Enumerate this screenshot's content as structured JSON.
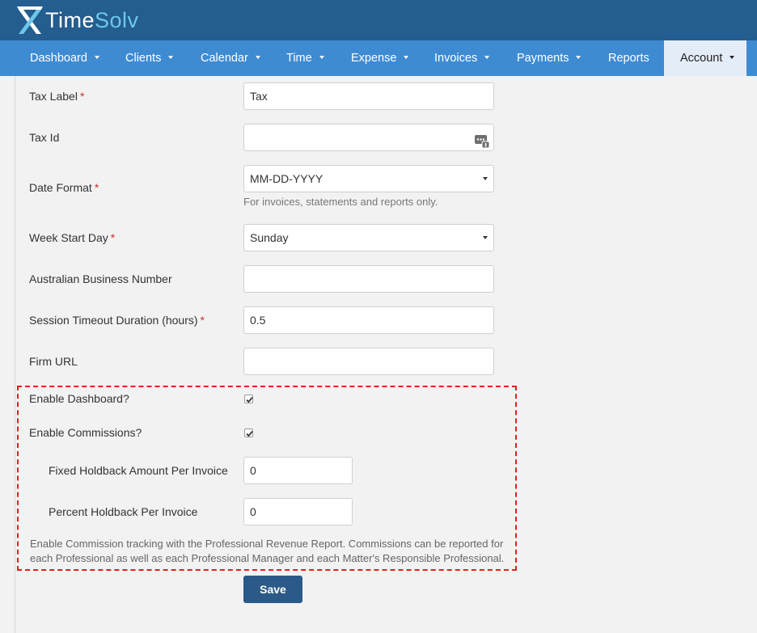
{
  "brand": {
    "logo_part1": "Time",
    "logo_part2": "Solv"
  },
  "nav": {
    "items": [
      {
        "label": "Dashboard"
      },
      {
        "label": "Clients"
      },
      {
        "label": "Calendar"
      },
      {
        "label": "Time"
      },
      {
        "label": "Expense"
      },
      {
        "label": "Invoices"
      },
      {
        "label": "Payments"
      },
      {
        "label": "Reports"
      },
      {
        "label": "Account"
      }
    ],
    "active": "Account"
  },
  "form": {
    "tax_label": {
      "label": "Tax Label",
      "required": "*",
      "value": "Tax"
    },
    "tax_id": {
      "label": "Tax Id",
      "value": ""
    },
    "date_format": {
      "label": "Date Format",
      "required": "*",
      "value": "MM-DD-YYYY",
      "help": "For invoices, statements and reports only."
    },
    "week_start_day": {
      "label": "Week Start Day",
      "required": "*",
      "value": "Sunday"
    },
    "abn": {
      "label": "Australian Business Number",
      "value": ""
    },
    "session_timeout": {
      "label": "Session Timeout Duration (hours)",
      "required": "*",
      "value": "0.5"
    },
    "firm_url": {
      "label": "Firm URL",
      "value": ""
    },
    "enable_dashboard": {
      "label": "Enable Dashboard?",
      "checked": true
    },
    "enable_commissions": {
      "label": "Enable Commissions?",
      "checked": true
    },
    "fixed_holdback": {
      "label": "Fixed Holdback Amount Per Invoice",
      "value": "0"
    },
    "percent_holdback": {
      "label": "Percent Holdback Per Invoice",
      "value": "0"
    },
    "commission_note": "Enable Commission tracking with the Professional Revenue Report. Commissions can be reported for each Professional as well as each Professional Manager and each Matter's Responsible Professional.",
    "save_label": "Save"
  },
  "colors": {
    "header_bg": "#245d8f",
    "nav_bg": "#3f8bd2",
    "nav_active_bg": "#e3edf8",
    "required": "#c9302c",
    "highlight_border": "#e02020",
    "save_button": "#2c5a88"
  },
  "icons": {
    "tax_id_field": "keyboard-dots-icon",
    "checkbox": "checkmark-icon",
    "logo": "timesolv-x-logo-icon"
  }
}
